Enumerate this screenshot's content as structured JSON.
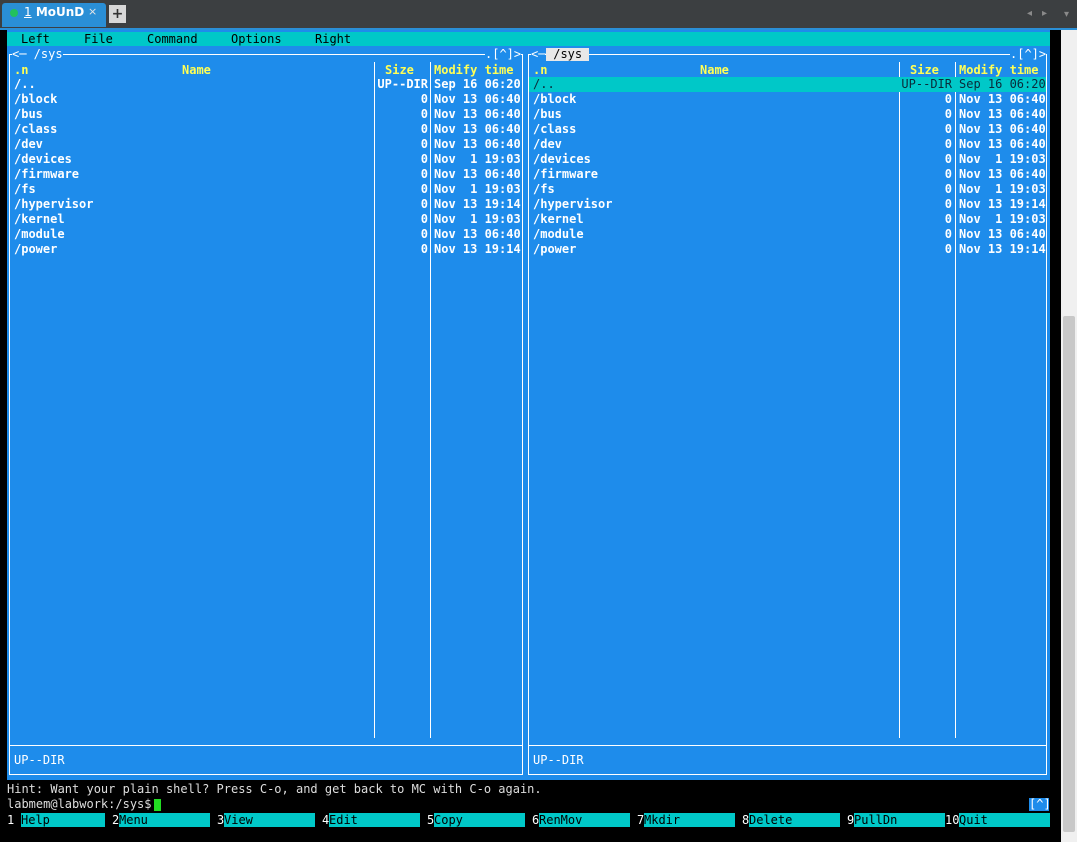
{
  "tab": {
    "number": "1",
    "title": "MoUnD",
    "close": "×",
    "add": "+"
  },
  "tabbar_nav": {
    "prev": "◂",
    "next": "▸",
    "menu": "▾"
  },
  "menu": [
    "Left",
    "File",
    "Command",
    "Options",
    "Right"
  ],
  "columns": {
    "name_short": ".n",
    "name": "Name",
    "size": "Size",
    "modify": "Modify",
    "time": "time"
  },
  "left_panel": {
    "path_left": "<─ /sys",
    "path_right": ".[^]>",
    "status": "UP--DIR",
    "files": [
      {
        "name": "/..",
        "size": "UP--DIR",
        "date": "Sep 16 06:20"
      },
      {
        "name": "/block",
        "size": "0",
        "date": "Nov 13 06:40"
      },
      {
        "name": "/bus",
        "size": "0",
        "date": "Nov 13 06:40"
      },
      {
        "name": "/class",
        "size": "0",
        "date": "Nov 13 06:40"
      },
      {
        "name": "/dev",
        "size": "0",
        "date": "Nov 13 06:40"
      },
      {
        "name": "/devices",
        "size": "0",
        "date": "Nov  1 19:03"
      },
      {
        "name": "/firmware",
        "size": "0",
        "date": "Nov 13 06:40"
      },
      {
        "name": "/fs",
        "size": "0",
        "date": "Nov  1 19:03"
      },
      {
        "name": "/hypervisor",
        "size": "0",
        "date": "Nov 13 19:14"
      },
      {
        "name": "/kernel",
        "size": "0",
        "date": "Nov  1 19:03"
      },
      {
        "name": "/module",
        "size": "0",
        "date": "Nov 13 06:40"
      },
      {
        "name": "/power",
        "size": "0",
        "date": "Nov 13 19:14"
      }
    ]
  },
  "right_panel": {
    "path_left": "<─",
    "path_active": " /sys ",
    "path_right": ".[^]>",
    "status": "UP--DIR",
    "files": [
      {
        "name": "/..",
        "size": "UP--DIR",
        "date": "Sep 16 06:20"
      },
      {
        "name": "/block",
        "size": "0",
        "date": "Nov 13 06:40"
      },
      {
        "name": "/bus",
        "size": "0",
        "date": "Nov 13 06:40"
      },
      {
        "name": "/class",
        "size": "0",
        "date": "Nov 13 06:40"
      },
      {
        "name": "/dev",
        "size": "0",
        "date": "Nov 13 06:40"
      },
      {
        "name": "/devices",
        "size": "0",
        "date": "Nov  1 19:03"
      },
      {
        "name": "/firmware",
        "size": "0",
        "date": "Nov 13 06:40"
      },
      {
        "name": "/fs",
        "size": "0",
        "date": "Nov  1 19:03"
      },
      {
        "name": "/hypervisor",
        "size": "0",
        "date": "Nov 13 19:14"
      },
      {
        "name": "/kernel",
        "size": "0",
        "date": "Nov  1 19:03"
      },
      {
        "name": "/module",
        "size": "0",
        "date": "Nov 13 06:40"
      },
      {
        "name": "/power",
        "size": "0",
        "date": "Nov 13 19:14"
      }
    ]
  },
  "hint": "Hint: Want your plain shell? Press C-o, and get back to MC with C-o again.",
  "prompt": "labmem@labwork:/sys$",
  "caret_button": "[^]",
  "fkeys": [
    {
      "num": "1",
      "label": "Help"
    },
    {
      "num": "2",
      "label": "Menu"
    },
    {
      "num": "3",
      "label": "View"
    },
    {
      "num": "4",
      "label": "Edit"
    },
    {
      "num": "5",
      "label": "Copy"
    },
    {
      "num": "6",
      "label": "RenMov"
    },
    {
      "num": "7",
      "label": "Mkdir"
    },
    {
      "num": "8",
      "label": "Delete"
    },
    {
      "num": "9",
      "label": "PullDn"
    },
    {
      "num": "10",
      "label": "Quit"
    }
  ],
  "colors": {
    "panel_bg": "#1e8ceb",
    "bar_cyan": "#00c8c8",
    "header_yellow": "#ffff55",
    "cursor_green": "#22dd22"
  }
}
